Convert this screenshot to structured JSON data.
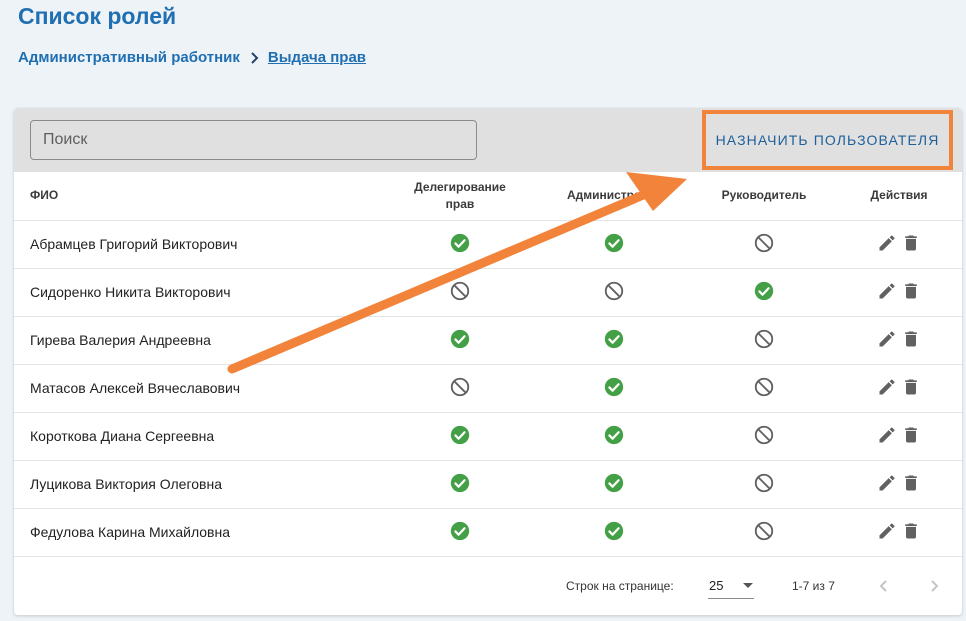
{
  "page": {
    "title": "Список ролей",
    "breadcrumb": {
      "parent": "Административный работник",
      "current": "Выдача прав"
    }
  },
  "toolbar": {
    "search_placeholder": "Поиск",
    "assign_button": "НАЗНАЧИТЬ ПОЛЬЗОВАТЕЛЯ"
  },
  "table": {
    "columns": {
      "fio": "ФИО",
      "delegation_line1": "Делегирование",
      "delegation_line2": "прав",
      "admin": "Администратор",
      "manager": "Руководитель",
      "actions": "Действия"
    },
    "rows": [
      {
        "name": "Абрамцев Григорий Викторович",
        "delegation": "yes",
        "admin": "yes",
        "manager": "no"
      },
      {
        "name": "Сидоренко Никита Викторович",
        "delegation": "no",
        "admin": "no",
        "manager": "yes"
      },
      {
        "name": "Гирева Валерия Андреевна",
        "delegation": "yes",
        "admin": "yes",
        "manager": "no"
      },
      {
        "name": "Матасов Алексей Вячеславович",
        "delegation": "no",
        "admin": "yes",
        "manager": "no"
      },
      {
        "name": "Короткова Диана Сергеевна",
        "delegation": "yes",
        "admin": "yes",
        "manager": "no"
      },
      {
        "name": "Луцикова Виктория Олеговна",
        "delegation": "yes",
        "admin": "yes",
        "manager": "no"
      },
      {
        "name": "Федулова Карина Михайловна",
        "delegation": "yes",
        "admin": "yes",
        "manager": "no"
      }
    ]
  },
  "pagination": {
    "rows_per_page_label": "Строк на странице:",
    "rows_per_page_value": "25",
    "range_text": "1-7 из 7"
  },
  "icons": {
    "yes": "check-circle-icon",
    "no": "block-icon",
    "edit": "pencil-icon",
    "delete": "trash-icon",
    "breadcrumb_separator": "chevron-right-icon",
    "select": "caret-down-icon",
    "prev": "chevron-left-icon",
    "next": "chevron-right-icon"
  },
  "colors": {
    "title": "#1f6fb2",
    "check": "#43a047",
    "block": "#616161",
    "action_icon": "#616161",
    "highlight": "#f2833b",
    "button_text": "#1f5f99"
  }
}
